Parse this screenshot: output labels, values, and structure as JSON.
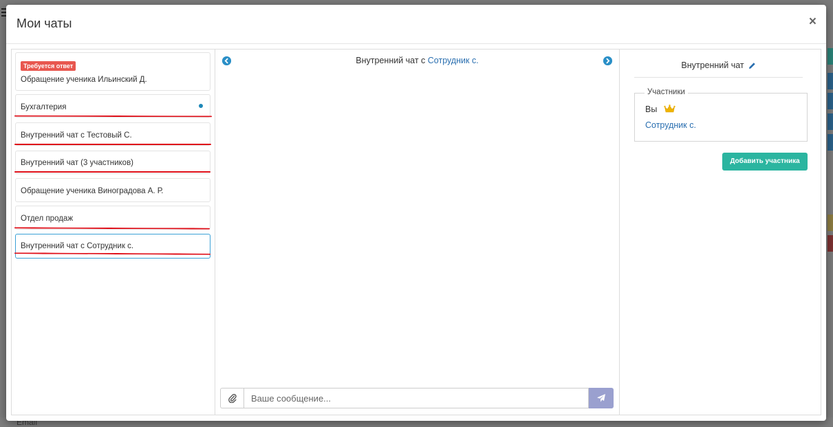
{
  "modal": {
    "title": "Мои чаты",
    "close_symbol": "×"
  },
  "background": {
    "email_label": "Email"
  },
  "chat_list": [
    {
      "badge": "Требуется ответ",
      "name": "Обращение ученика Ильинский Д.",
      "unread": false,
      "active": false,
      "underlined": false
    },
    {
      "badge": "",
      "name": "Бухгалтерия",
      "unread": true,
      "active": false,
      "underlined": true
    },
    {
      "badge": "",
      "name": "Внутренний чат с Тестовый С.",
      "unread": false,
      "active": false,
      "underlined": true
    },
    {
      "badge": "",
      "name": "Внутренний чат (3 участников)",
      "unread": false,
      "active": false,
      "underlined": true
    },
    {
      "badge": "",
      "name": "Обращение ученика Виноградова А. Р.",
      "unread": false,
      "active": false,
      "underlined": false
    },
    {
      "badge": "",
      "name": "Отдел продаж",
      "unread": false,
      "active": false,
      "underlined": true
    },
    {
      "badge": "",
      "name": "Внутренний чат с Сотрудник с.",
      "unread": false,
      "active": true,
      "underlined": true
    }
  ],
  "conversation": {
    "title_prefix": "Внутренний чат с ",
    "title_link": "Сотрудник с.",
    "prev_icon": "chevron-left-circle-icon",
    "next_icon": "chevron-right-circle-icon",
    "message_placeholder": "Ваше сообщение...",
    "message_value": "",
    "attach_icon": "paperclip-icon",
    "send_icon": "paper-plane-icon"
  },
  "details": {
    "title": "Внутренний чат",
    "edit_icon": "pencil-icon",
    "participants_legend": "Участники",
    "participants": [
      {
        "name": "Вы",
        "owner": true
      },
      {
        "name": "Сотрудник с.",
        "owner": false
      }
    ],
    "add_button": "Добавить участника"
  },
  "colors": {
    "accent_teal": "#2bb5a0",
    "link_blue": "#2a6fb0",
    "badge_red": "#e8574f",
    "send_button": "#9aa0cf",
    "crown_gold": "#f0b400"
  }
}
